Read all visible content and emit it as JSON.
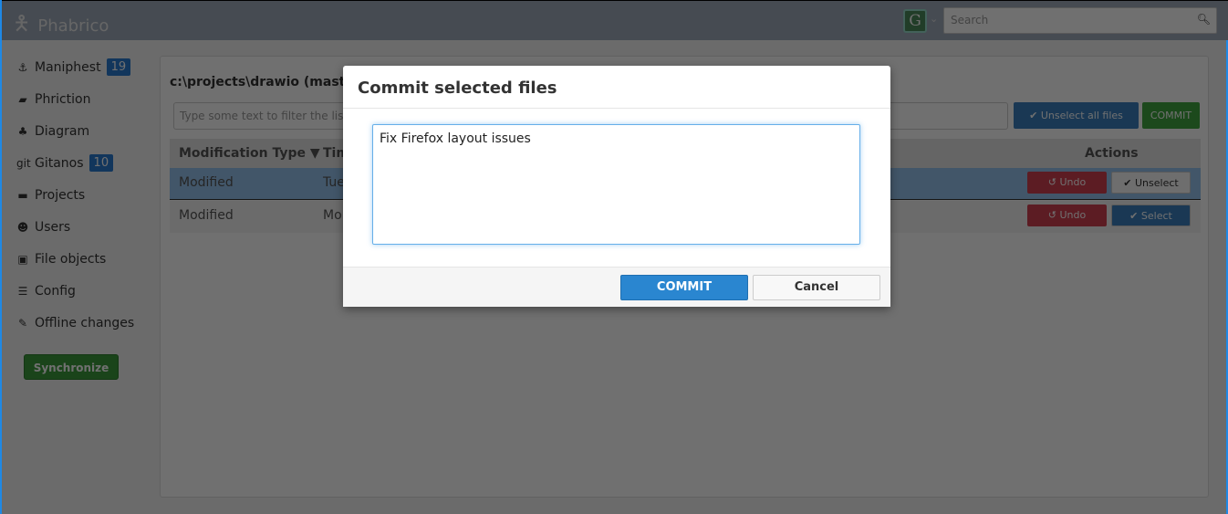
{
  "app": {
    "title": "Phabrico",
    "user_initial": "G",
    "search_placeholder": "Search"
  },
  "sidebar": {
    "items": [
      {
        "label": "Maniphest",
        "icon": "anchor-icon",
        "glyph": "⚓",
        "badge": "19"
      },
      {
        "label": "Phriction",
        "icon": "book-icon",
        "glyph": "▰"
      },
      {
        "label": "Diagram",
        "icon": "sitemap-icon",
        "glyph": "♣"
      },
      {
        "label": "Gitanos",
        "icon": "git-icon",
        "glyph": "git",
        "badge": "10"
      },
      {
        "label": "Projects",
        "icon": "briefcase-icon",
        "glyph": "▬"
      },
      {
        "label": "Users",
        "icon": "users-icon",
        "glyph": "☻"
      },
      {
        "label": "File objects",
        "icon": "file-image-icon",
        "glyph": "▣"
      },
      {
        "label": "Config",
        "icon": "sliders-icon",
        "glyph": "☰"
      },
      {
        "label": "Offline changes",
        "icon": "pencil-icon",
        "glyph": "✎"
      }
    ],
    "sync_label": "Synchronize"
  },
  "main": {
    "title": "c:\\projects\\drawio (master)",
    "filter_placeholder": "Type some text to filter the list",
    "unselect_all": "✔ Unselect all files",
    "commit": "COMMIT",
    "columns": {
      "type": "Modification Type ▼",
      "time": "Time",
      "actions": "Actions"
    },
    "rows": [
      {
        "type": "Modified",
        "time": "Tue",
        "undo": "↺ Undo",
        "toggle": "✔ Unselect",
        "selected": true
      },
      {
        "type": "Modified",
        "time": "Mo",
        "undo": "↺ Undo",
        "toggle": "✔ Select",
        "selected": false
      }
    ]
  },
  "modal": {
    "title": "Commit selected files",
    "message": "Fix Firefox layout issues",
    "commit": "COMMIT",
    "cancel": "Cancel"
  }
}
